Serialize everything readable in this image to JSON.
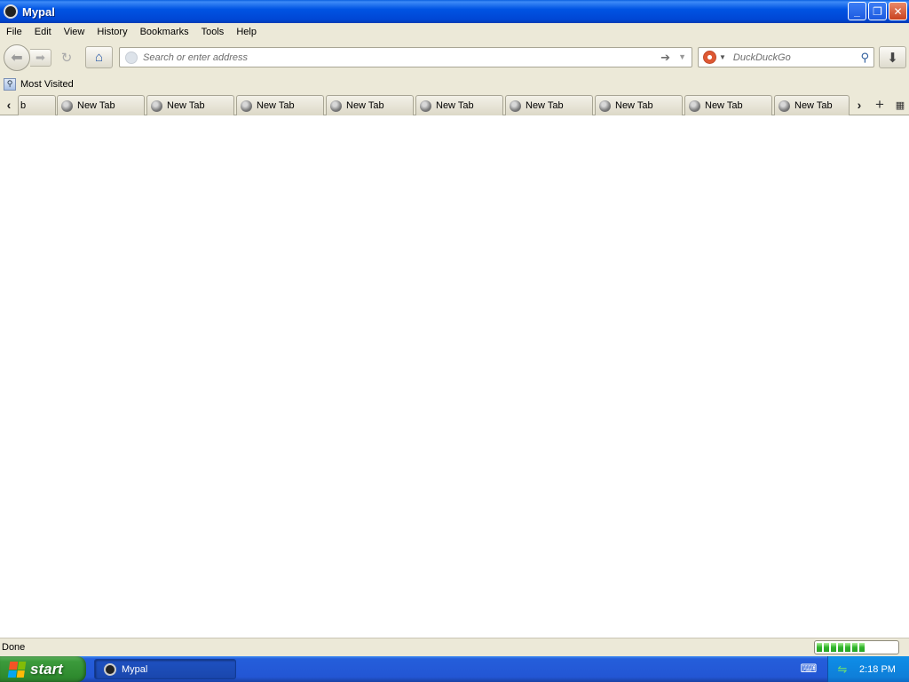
{
  "window": {
    "title": "Mypal",
    "controls": {
      "minimize": "_",
      "restore": "❐",
      "close": "✕"
    }
  },
  "menu": [
    "File",
    "Edit",
    "View",
    "History",
    "Bookmarks",
    "Tools",
    "Help"
  ],
  "toolbar": {
    "address_placeholder": "Search or enter address",
    "search_engine": "DuckDuckGo"
  },
  "bookmarks": {
    "items": [
      {
        "label": "Most Visited"
      }
    ]
  },
  "tabs": {
    "partial_label": "b",
    "items": [
      {
        "label": "New Tab"
      },
      {
        "label": "New Tab"
      },
      {
        "label": "New Tab"
      },
      {
        "label": "New Tab"
      },
      {
        "label": "New Tab"
      },
      {
        "label": "New Tab"
      },
      {
        "label": "New Tab"
      },
      {
        "label": "New Tab"
      },
      {
        "label": "New Tab"
      }
    ]
  },
  "status": {
    "text": "Done",
    "progress_segments": 7
  },
  "taskbar": {
    "start_label": "start",
    "task_label": "Mypal",
    "clock": "2:18 PM"
  },
  "colors": {
    "title_blue": "#0054e3",
    "chrome_beige": "#ece9d8",
    "start_green": "#3c9b3c",
    "tray_blue": "#0f7fd9"
  },
  "icons": {
    "back": "back-arrow-icon",
    "forward": "forward-arrow-icon",
    "reload": "reload-icon",
    "home": "home-icon",
    "download": "download-icon",
    "search": "magnifier-icon"
  }
}
